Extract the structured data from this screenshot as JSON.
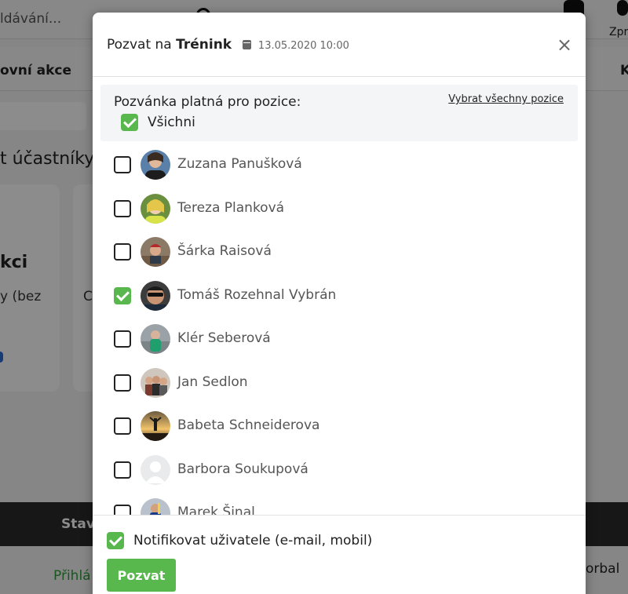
{
  "background": {
    "search_text": "ldávání...",
    "messages_label": "Zpr",
    "subnav_left": "ovní akce",
    "subnav_right": "K",
    "section_heading": "t účastníky",
    "card_title": "kci",
    "card_text": "y (bez",
    "card2_text": "C",
    "darkbar_label": "Stav",
    "bottom_left": "Přihlá",
    "bottom_right": "orbal"
  },
  "modal": {
    "title_prefix": "Pozvat na",
    "event_name": "Trénink",
    "event_datetime": "13.05.2020 10:00",
    "close_symbol": "×",
    "positions_label": "Pozvánka platná pro pozice:",
    "select_all_positions": "Vybrat všechny pozice",
    "all_positions_label": "Všichni",
    "all_positions_checked": true,
    "members": [
      {
        "name": "Zuzana Panušková",
        "checked": false,
        "avatar": "photo-avatar"
      },
      {
        "name": "Tereza Planková",
        "checked": false,
        "avatar": "photo-avatar"
      },
      {
        "name": "Šárka Raisová",
        "checked": false,
        "avatar": "photo-avatar"
      },
      {
        "name": "Tomáš Rozehnal  Vybrán",
        "checked": true,
        "avatar": "photo-avatar"
      },
      {
        "name": "Klér Seberová",
        "checked": false,
        "avatar": "photo-avatar"
      },
      {
        "name": "Jan Sedlon",
        "checked": false,
        "avatar": "photo-avatar"
      },
      {
        "name": "Babeta Schneiderova",
        "checked": false,
        "avatar": "photo-avatar"
      },
      {
        "name": "Barbora Soukupová",
        "checked": false,
        "avatar": "default-avatar"
      },
      {
        "name": "Marek Šinal",
        "checked": false,
        "avatar": "photo-avatar"
      }
    ],
    "notify_label": "Notifikovat uživatele (e-mail, mobil)",
    "notify_checked": true,
    "submit_label": "Pozvat"
  },
  "colors": {
    "accent_green": "#59b84d",
    "overlay": "rgba(0,0,0,0.45)"
  }
}
